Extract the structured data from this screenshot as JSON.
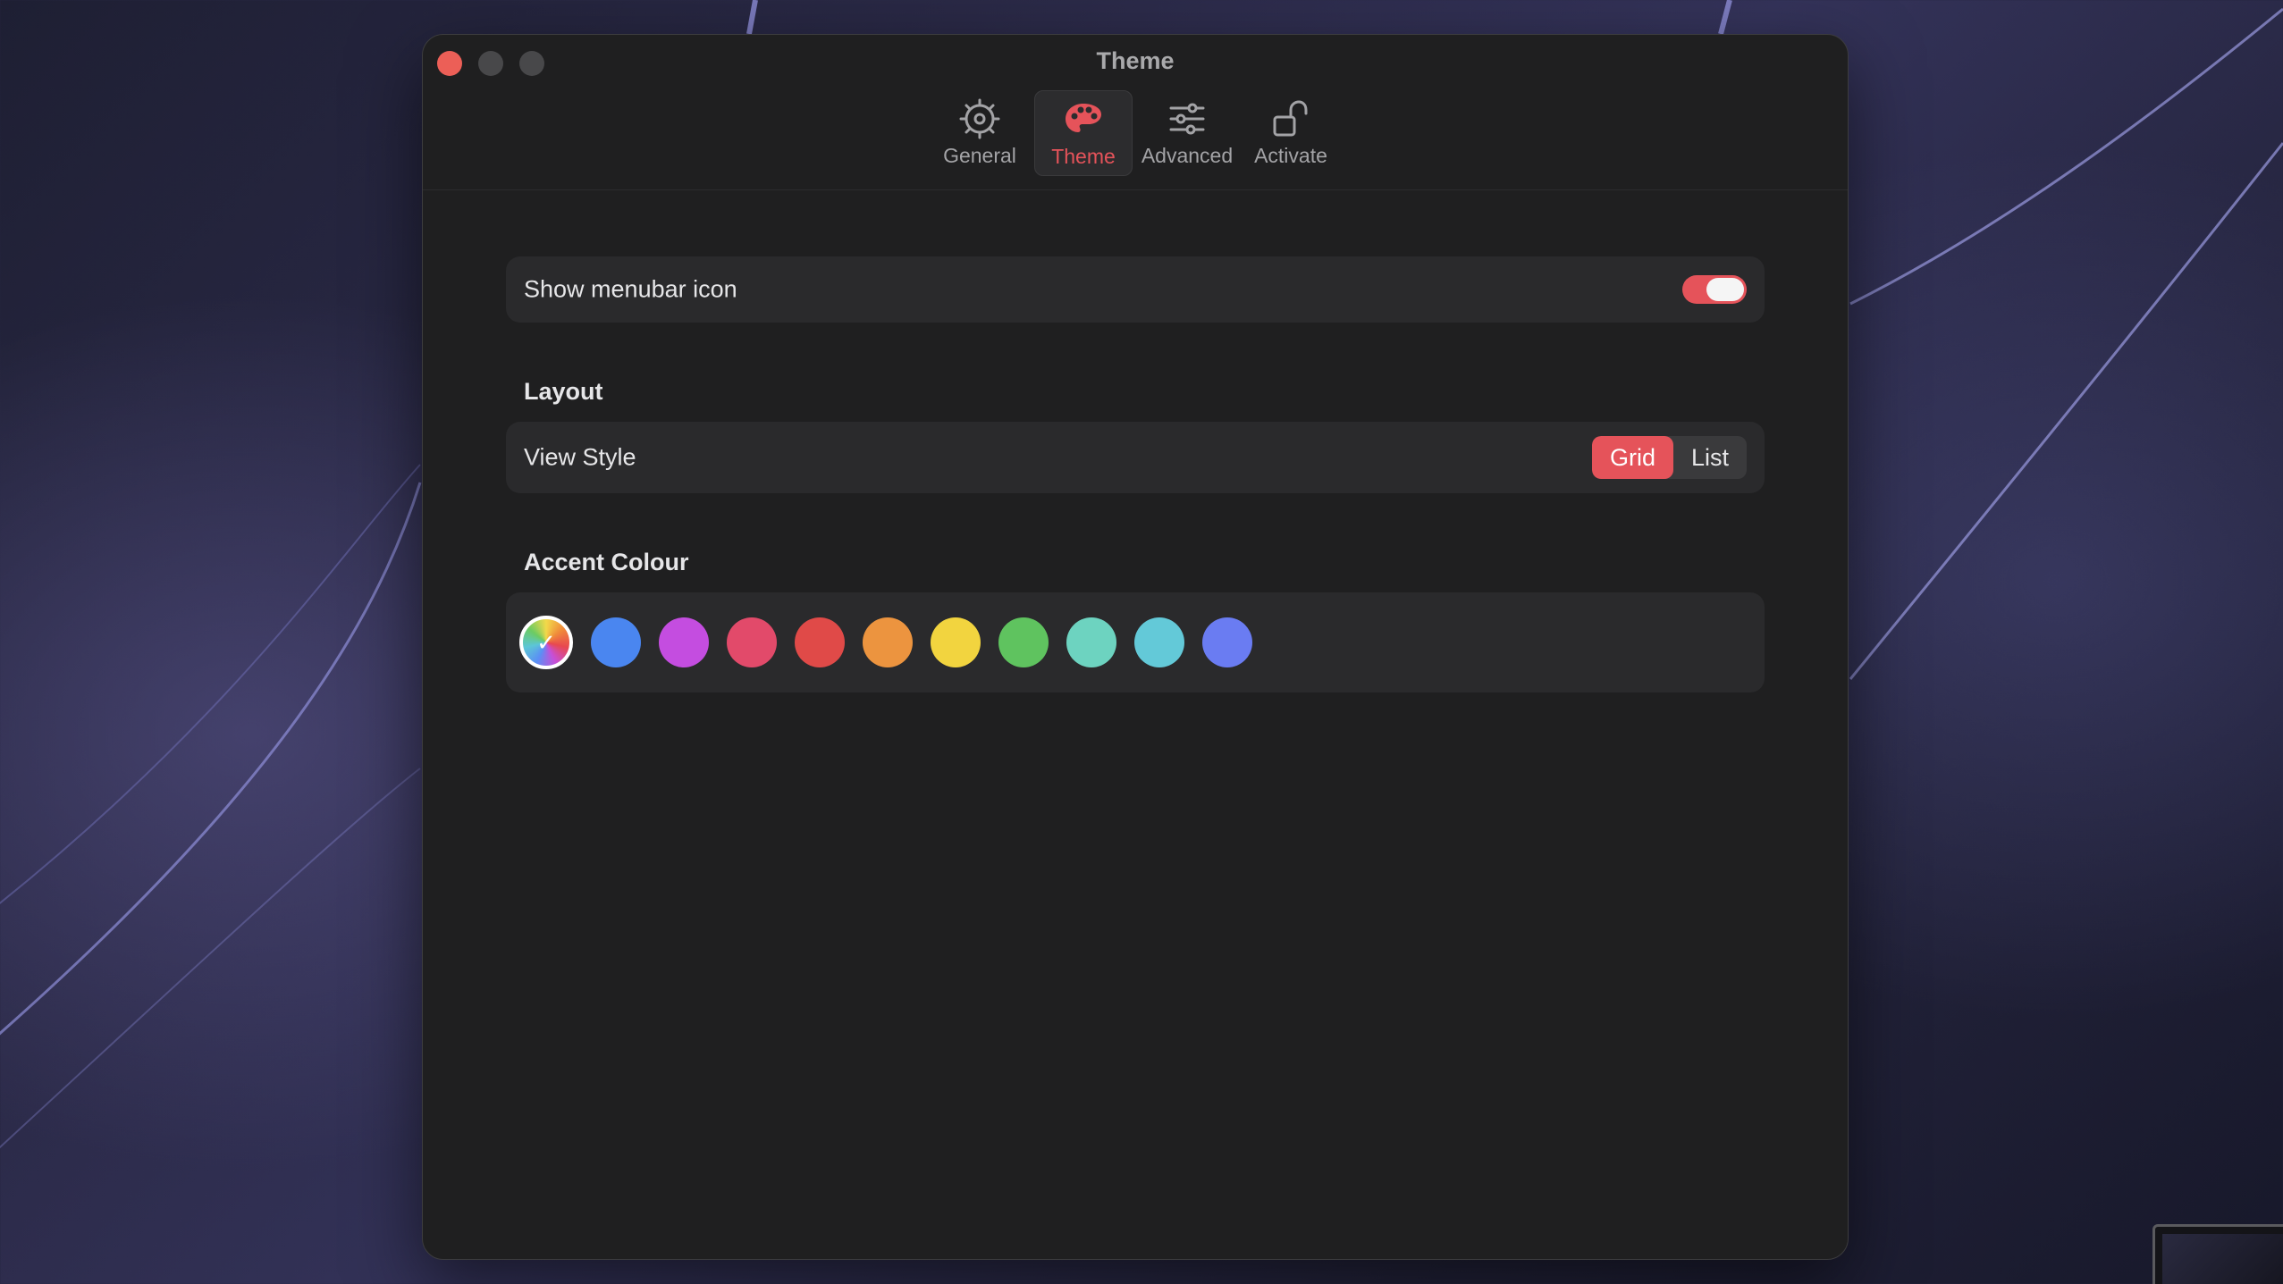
{
  "window": {
    "title": "Theme"
  },
  "tabs": [
    {
      "label": "General",
      "icon": "gear-icon",
      "active": false
    },
    {
      "label": "Theme",
      "icon": "palette-icon",
      "active": true
    },
    {
      "label": "Advanced",
      "icon": "sliders-icon",
      "active": false
    },
    {
      "label": "Activate",
      "icon": "unlock-icon",
      "active": false
    }
  ],
  "menubar": {
    "label": "Show menubar icon",
    "enabled": true
  },
  "layout": {
    "heading": "Layout",
    "view_style_label": "View Style",
    "options": [
      "Grid",
      "List"
    ],
    "selected": "Grid"
  },
  "accent": {
    "heading": "Accent Colour",
    "check": "✓",
    "colors": [
      "multicolor",
      "#4a86f0",
      "#c44de0",
      "#e24a6a",
      "#e04a48",
      "#ec943f",
      "#f2d43f",
      "#5fc35f",
      "#6dd3c0",
      "#63c9d8",
      "#6a7cf2"
    ],
    "selected": "multicolor"
  },
  "colors": {
    "accent": "#e5535a",
    "window_bg": "#1f1f20",
    "row_bg": "#2a2a2c"
  }
}
